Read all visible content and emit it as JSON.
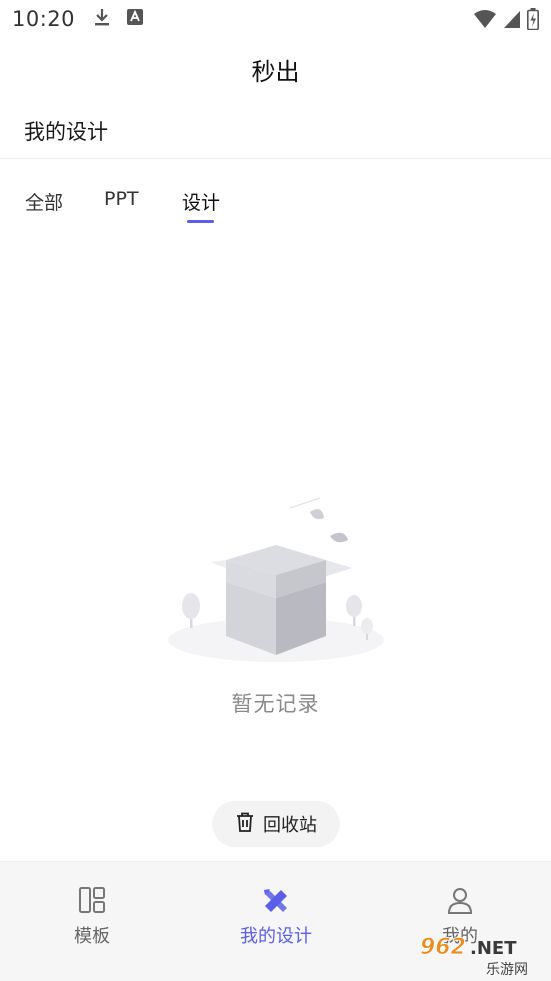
{
  "status_bar": {
    "time": "10:20",
    "left_icons": [
      "download-icon",
      "a-letter-icon"
    ],
    "right_icons": [
      "wifi-icon",
      "signal-icon",
      "battery-icon"
    ]
  },
  "header": {
    "title": "秒出"
  },
  "section": {
    "title": "我的设计"
  },
  "tabs": [
    {
      "label": "全部",
      "active": false
    },
    {
      "label": "PPT",
      "active": false
    },
    {
      "label": "设计",
      "active": true
    }
  ],
  "empty_state": {
    "icon": "empty-box-icon",
    "text": "暂无记录"
  },
  "recycle_bin": {
    "label": "回收站",
    "icon": "trash-icon"
  },
  "bottom_nav": [
    {
      "label": "模板",
      "icon": "template-grid-icon",
      "active": false
    },
    {
      "label": "我的设计",
      "icon": "design-tools-icon",
      "active": true
    },
    {
      "label": "我的",
      "icon": "user-icon",
      "active": false
    }
  ],
  "watermark": {
    "text_top": "962.NET",
    "text_bottom": "乐游网"
  },
  "colors": {
    "accent": "#5b5fe8",
    "nav_background": "#f6f6f6",
    "muted_text": "#8a8a8a"
  }
}
